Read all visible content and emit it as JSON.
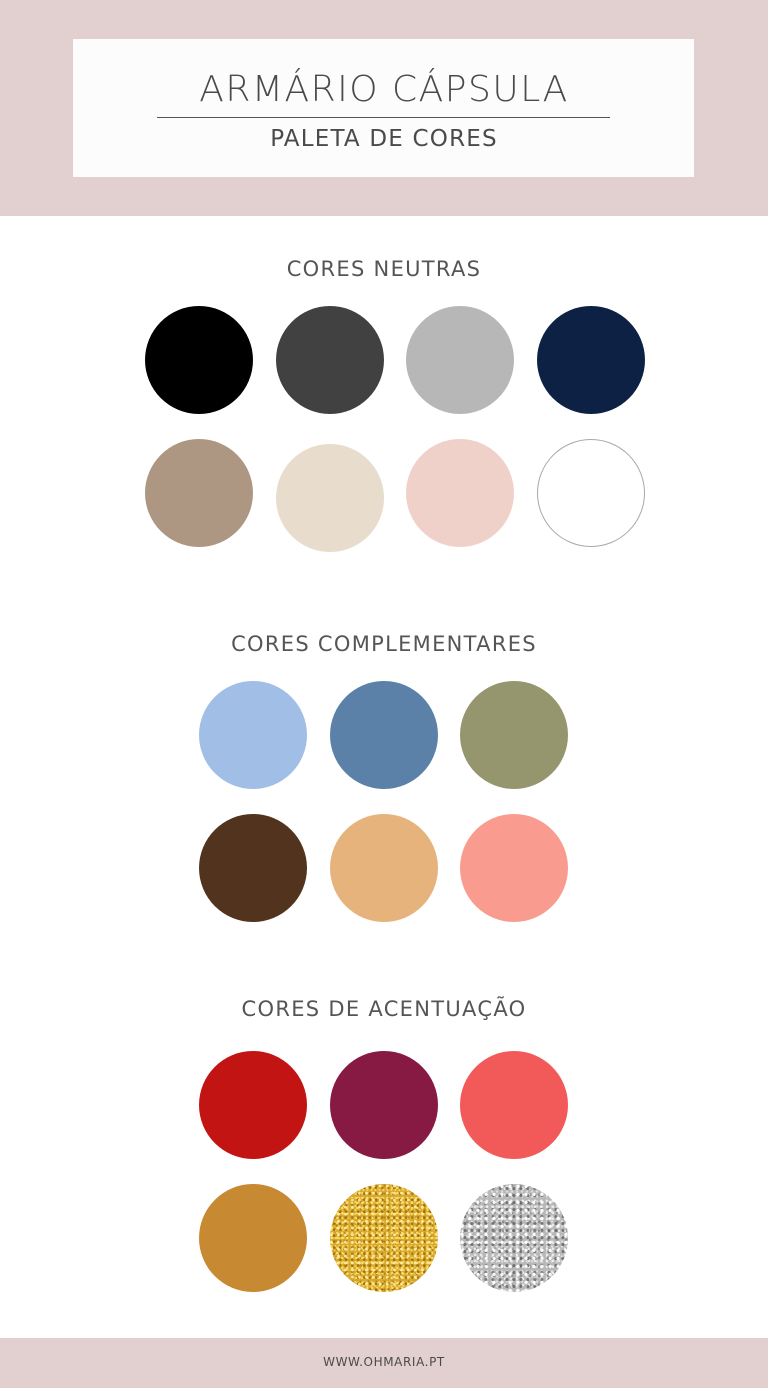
{
  "header": {
    "title": "ARMÁRIO CÁPSULA",
    "subtitle": "PALETA DE CORES"
  },
  "sections": [
    {
      "heading": "CORES NEUTRAS",
      "swatches": [
        {
          "name": "black",
          "color": "#000000"
        },
        {
          "name": "charcoal",
          "color": "#414141"
        },
        {
          "name": "light-gray",
          "color": "#b7b7b7"
        },
        {
          "name": "navy",
          "color": "#0c2144"
        },
        {
          "name": "taupe",
          "color": "#ad9783"
        },
        {
          "name": "cream",
          "color": "#e8dccc"
        },
        {
          "name": "blush",
          "color": "#f0d1ca"
        },
        {
          "name": "white",
          "color": "#ffffff"
        }
      ]
    },
    {
      "heading": "CORES COMPLEMENTARES",
      "swatches": [
        {
          "name": "light-blue",
          "color": "#a1bee6"
        },
        {
          "name": "steel-blue",
          "color": "#5b81a8"
        },
        {
          "name": "olive",
          "color": "#95966d"
        },
        {
          "name": "chocolate",
          "color": "#52331e"
        },
        {
          "name": "apricot",
          "color": "#e6b37d"
        },
        {
          "name": "salmon",
          "color": "#f99c8f"
        }
      ]
    },
    {
      "heading": "CORES DE ACENTUAÇÃO",
      "swatches": [
        {
          "name": "red",
          "color": "#c31414"
        },
        {
          "name": "burgundy",
          "color": "#861a43"
        },
        {
          "name": "coral",
          "color": "#f25a59"
        },
        {
          "name": "mustard",
          "color": "#c78931"
        },
        {
          "name": "gold-glitter",
          "color": "#d8a829"
        },
        {
          "name": "silver-glitter",
          "color": "#b8b8b8"
        }
      ]
    }
  ],
  "footer": {
    "text": "WWW.OHMARIA.PT"
  }
}
